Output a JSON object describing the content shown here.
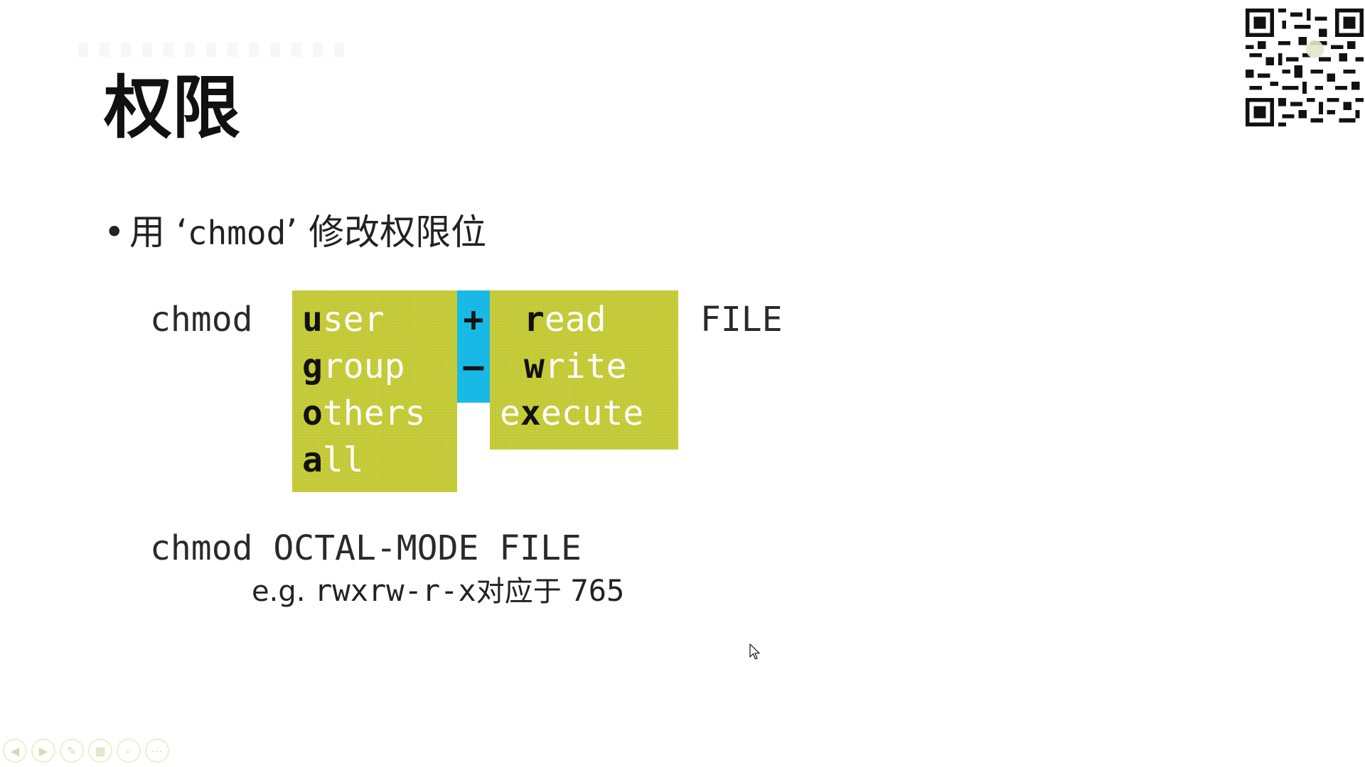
{
  "slide": {
    "title": "权限",
    "bullet": {
      "marker": "•",
      "prefix": "用 ‘",
      "command": "chmod",
      "suffix": "’ 修改权限位"
    },
    "symbolic_syntax": {
      "command": "chmod",
      "who": [
        {
          "key": "u",
          "rest": "ser"
        },
        {
          "key": "g",
          "rest": "roup"
        },
        {
          "key": "o",
          "rest": "thers"
        },
        {
          "key": "a",
          "rest": "ll"
        }
      ],
      "operators": [
        "+",
        "–"
      ],
      "permissions": [
        {
          "pre": "",
          "key": "r",
          "rest": "ead"
        },
        {
          "pre": "",
          "key": "w",
          "rest": "rite"
        },
        {
          "pre": "e",
          "key": "x",
          "rest": "ecute"
        }
      ],
      "target": "FILE"
    },
    "octal_syntax": {
      "text": "chmod OCTAL-MODE FILE"
    },
    "example": {
      "prefix": "e.g.",
      "mode": "rwxrw-r-x",
      "middle": "对应于",
      "octal": "765"
    }
  },
  "colors": {
    "green_box": "#c3c934",
    "blue_box": "#18b9e6",
    "option_text": "#ffffff",
    "key_letter": "#111111"
  },
  "icons": {
    "qr": "qr-code-icon",
    "cursor": "mouse-cursor-icon",
    "nav": [
      "previous-icon",
      "next-icon",
      "pen-icon",
      "slides-icon",
      "zoom-icon",
      "more-icon"
    ]
  }
}
